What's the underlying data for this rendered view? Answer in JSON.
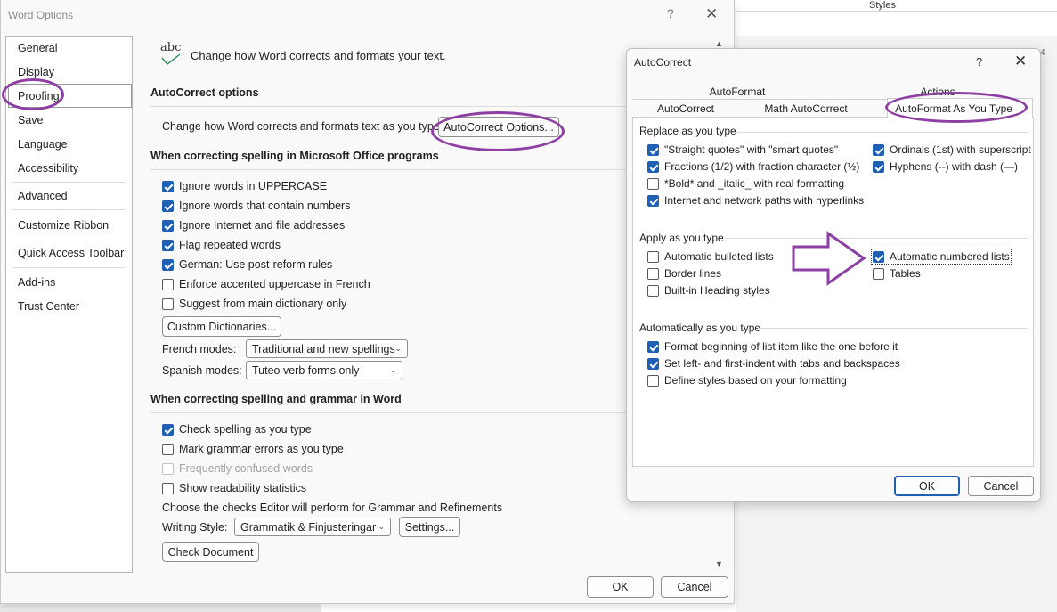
{
  "background": {
    "styles_title": "Styles",
    "ruler_text": "4"
  },
  "word_options": {
    "title": "Word Options",
    "help": "?",
    "close": "✕",
    "nav": [
      {
        "label": "General"
      },
      {
        "label": "Display"
      },
      {
        "label": "Proofing"
      },
      {
        "label": "Save"
      },
      {
        "label": "Language"
      },
      {
        "label": "Accessibility"
      },
      {
        "label": "Advanced"
      },
      {
        "label": "Customize Ribbon"
      },
      {
        "label": "Quick Access Toolbar"
      },
      {
        "label": "Add-ins"
      },
      {
        "label": "Trust Center"
      }
    ],
    "header_icon_text": "abc",
    "header_text": "Change how Word corrects and formats your text.",
    "autocorrect_section": "AutoCorrect options",
    "autocorrect_desc": "Change how Word corrects and formats text as you type:",
    "autocorrect_button": "AutoCorrect Options...",
    "spelling_section": "When correcting spelling in Microsoft Office programs",
    "spelling_options": [
      {
        "label": "Ignore words in UPPERCASE",
        "checked": true
      },
      {
        "label": "Ignore words that contain numbers",
        "checked": true
      },
      {
        "label": "Ignore Internet and file addresses",
        "checked": true
      },
      {
        "label": "Flag repeated words",
        "checked": true
      },
      {
        "label": "German: Use post-reform rules",
        "checked": true
      },
      {
        "label": "Enforce accented uppercase in French",
        "checked": false
      },
      {
        "label": "Suggest from main dictionary only",
        "checked": false
      }
    ],
    "custom_dict_button": "Custom Dictionaries...",
    "french_modes_label": "French modes:",
    "french_modes_value": "Traditional and new spellings",
    "spanish_modes_label": "Spanish modes:",
    "spanish_modes_value": "Tuteo verb forms only",
    "grammar_section": "When correcting spelling and grammar in Word",
    "grammar_options": [
      {
        "label": "Check spelling as you type",
        "checked": true,
        "disabled": false
      },
      {
        "label": "Mark grammar errors as you type",
        "checked": false,
        "disabled": false
      },
      {
        "label": "Frequently confused words",
        "checked": false,
        "disabled": true
      },
      {
        "label": "Show readability statistics",
        "checked": false,
        "disabled": false
      }
    ],
    "editor_desc": "Choose the checks Editor will perform for Grammar and Refinements",
    "writing_style_label": "Writing Style:",
    "writing_style_value": "Grammatik & Finjusteringar",
    "settings_button": "Settings...",
    "check_document_button": "Check Document",
    "ok": "OK",
    "cancel": "Cancel"
  },
  "autocorrect": {
    "title": "AutoCorrect",
    "help": "?",
    "close": "✕",
    "tabs_row1": [
      "AutoFormat",
      "Actions"
    ],
    "tabs_row2": [
      "AutoCorrect",
      "Math AutoCorrect",
      "AutoFormat As You Type"
    ],
    "active_tab": "AutoFormat As You Type",
    "replace_section": "Replace as you type",
    "replace_left": [
      {
        "label": "\"Straight quotes\" with \"smart quotes\"",
        "checked": true
      },
      {
        "label": "Fractions (1/2) with fraction character (½)",
        "checked": true
      },
      {
        "label": "*Bold* and _italic_ with real formatting",
        "checked": false
      },
      {
        "label": "Internet and network paths with hyperlinks",
        "checked": true
      }
    ],
    "replace_right": [
      {
        "label": "Ordinals (1st) with superscript",
        "checked": true
      },
      {
        "label": "Hyphens (--) with dash (—)",
        "checked": true
      }
    ],
    "apply_section": "Apply as you type",
    "apply_left": [
      {
        "label": "Automatic bulleted lists",
        "checked": false
      },
      {
        "label": "Border lines",
        "checked": false
      },
      {
        "label": "Built-in Heading styles",
        "checked": false
      }
    ],
    "apply_right": [
      {
        "label": "Automatic numbered lists",
        "checked": true
      },
      {
        "label": "Tables",
        "checked": false
      }
    ],
    "auto_section": "Automatically as you type",
    "auto_options": [
      {
        "label": "Format beginning of list item like the one before it",
        "checked": true
      },
      {
        "label": "Set left- and first-indent with tabs and backspaces",
        "checked": true
      },
      {
        "label": "Define styles based on your formatting",
        "checked": false
      }
    ],
    "ok": "OK",
    "cancel": "Cancel"
  },
  "colors": {
    "accent": "#1f5fb4",
    "highlight": "#8e3fa3"
  }
}
